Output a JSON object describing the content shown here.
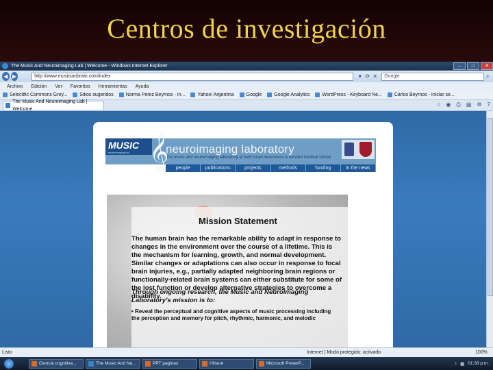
{
  "slide": {
    "title": "Centros de investigación"
  },
  "browser": {
    "window_title": "The Music And Neuroimaging Lab | Welcome - Windows Internet Explorer",
    "url": "http://www.musicianbrain.com/index",
    "search_placeholder": "Google",
    "menu": [
      "Archivo",
      "Edición",
      "Ver",
      "Favoritos",
      "Herramientas",
      "Ayuda"
    ],
    "favorites": [
      "Selectific Commons Grey...",
      "Sitios sugeridos",
      "Norma Perez Beyrnos - In...",
      "Yahoo! Argentina",
      "Google",
      "Google Analytics",
      "WordPress - Keyboard Ne...",
      "Carlos Beyrnos - Iniciar se..."
    ],
    "tab_title": "The Music And Neuroimaging Lab | Welcome",
    "status_left": "Listo",
    "status_zone": "Internet | Modo protegido: activado",
    "zoom": "100%"
  },
  "page": {
    "brand": "MUSIC",
    "brand_sub": "neuroimaging lab",
    "lab_title": "neuroimaging laboratory",
    "lab_subtitle": "the music and neuroimaging laboratory at beth israel deaconess & harvard medical school",
    "nav": [
      "people",
      "publications",
      "projects",
      "methods",
      "funding",
      "in the news"
    ],
    "mission_title": "Mission Statement",
    "mission_text": "The human brain has the remarkable ability to adapt in response to changes in the environment over the course of a lifetime. This is the mechanism for learning, growth, and normal development. Similar changes or adaptations can also occur in response to focal brain injuries, e.g., partially adapted neighboring brain regions or functionally-related brain systems can either substitute for some of the lost function or develop alternative strategies to overcome a disability.",
    "mission_intro": "Through ongoing research, the Music and Neuroimaging Laboratory's mission is to:",
    "mission_bullet": "• Reveal the perceptual and cognitive aspects of music processing including the perception and memory for pitch, rhythmic, harmonic, and melodic"
  },
  "taskbar": {
    "tasks": [
      "Ciencia cognitiva...",
      "The Music And Ne...",
      "PPT paginas",
      "Hilsure",
      "Microsoft PowerP..."
    ],
    "clock": "01:33 p.m."
  }
}
